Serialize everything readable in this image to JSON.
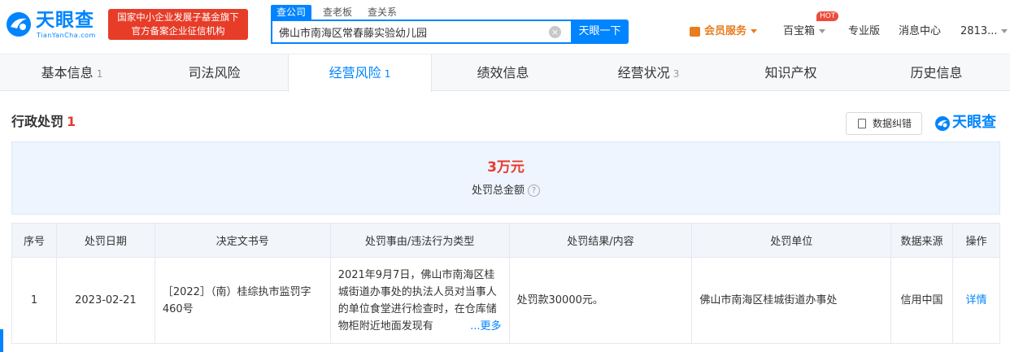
{
  "header": {
    "logo_text": "天眼查",
    "logo_sub": "TianYanCha.com",
    "badge_line1": "国家中小企业发展子基金旗下",
    "badge_line2": "官方备案企业征信机构",
    "search_tabs": [
      "查公司",
      "查老板",
      "查关系"
    ],
    "search_value": "佛山市南海区常春藤实验幼儿园",
    "search_button": "天眼一下",
    "vip_label": "会员服务",
    "treasure_label": "百宝箱",
    "hot_label": "HOT",
    "pro_label": "专业版",
    "message_label": "消息中心",
    "user_label": "2813..."
  },
  "tabs": [
    {
      "label": "基本信息",
      "count": "1"
    },
    {
      "label": "司法风险",
      "count": ""
    },
    {
      "label": "经营风险",
      "count": "1"
    },
    {
      "label": "绩效信息",
      "count": ""
    },
    {
      "label": "经营状况",
      "count": "3"
    },
    {
      "label": "知识产权",
      "count": ""
    },
    {
      "label": "历史信息",
      "count": ""
    }
  ],
  "section": {
    "title": "行政处罚",
    "count": "1",
    "report_label": "数据纠错",
    "brand": "天眼查"
  },
  "summary": {
    "amount": "3万元",
    "label": "处罚总金额",
    "help": "?"
  },
  "table": {
    "headers": [
      "序号",
      "处罚日期",
      "决定文书号",
      "处罚事由/违法行为类型",
      "处罚结果/内容",
      "处罚单位",
      "数据来源",
      "操作"
    ],
    "rows": [
      {
        "index": "1",
        "date": "2023-02-21",
        "doc_no": "［2022］（南）桂综执市监罚字460号",
        "reason": "2021年9月7日，佛山市南海区桂城街道办事处的执法人员对当事人的单位食堂进行检查时，在仓库储物柜附近地面发现有",
        "more": "...更多",
        "result": "处罚款30000元。",
        "authority": "佛山市南海区桂城街道办事处",
        "source": "信用中国",
        "action": "详情"
      }
    ]
  },
  "colors": {
    "brand": "#0084ff",
    "accent_red": "#e83b2e",
    "vip": "#e87c1e"
  }
}
